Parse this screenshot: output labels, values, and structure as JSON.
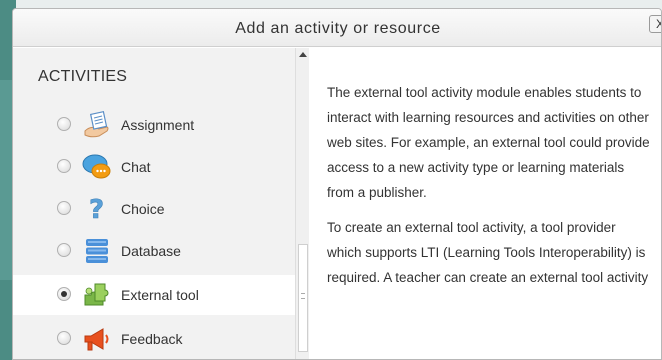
{
  "dialog": {
    "title": "Add an activity or resource",
    "close_label": "X"
  },
  "left": {
    "heading": "ACTIVITIES",
    "items": [
      {
        "label": "Assignment",
        "selected": false,
        "icon": "assignment-icon"
      },
      {
        "label": "Chat",
        "selected": false,
        "icon": "chat-icon"
      },
      {
        "label": "Choice",
        "selected": false,
        "icon": "choice-icon"
      },
      {
        "label": "Database",
        "selected": false,
        "icon": "database-icon"
      },
      {
        "label": "External tool",
        "selected": true,
        "icon": "external-tool-icon"
      },
      {
        "label": "Feedback",
        "selected": false,
        "icon": "feedback-icon"
      }
    ]
  },
  "description": {
    "paragraphs": [
      "The external tool activity module enables students to interact with learning resources and activities on other web sites. For example, an external tool could provide access to a new activity type or learning materials from a publisher.",
      "To create an external tool activity, a tool provider which supports LTI (Learning Tools Interoperability) is required. A teacher can create an external tool activity"
    ]
  },
  "colors": {
    "accent_teal": "#4c8c84",
    "selected_bg": "#ffffff",
    "pane_bg": "#f2f2f2"
  }
}
